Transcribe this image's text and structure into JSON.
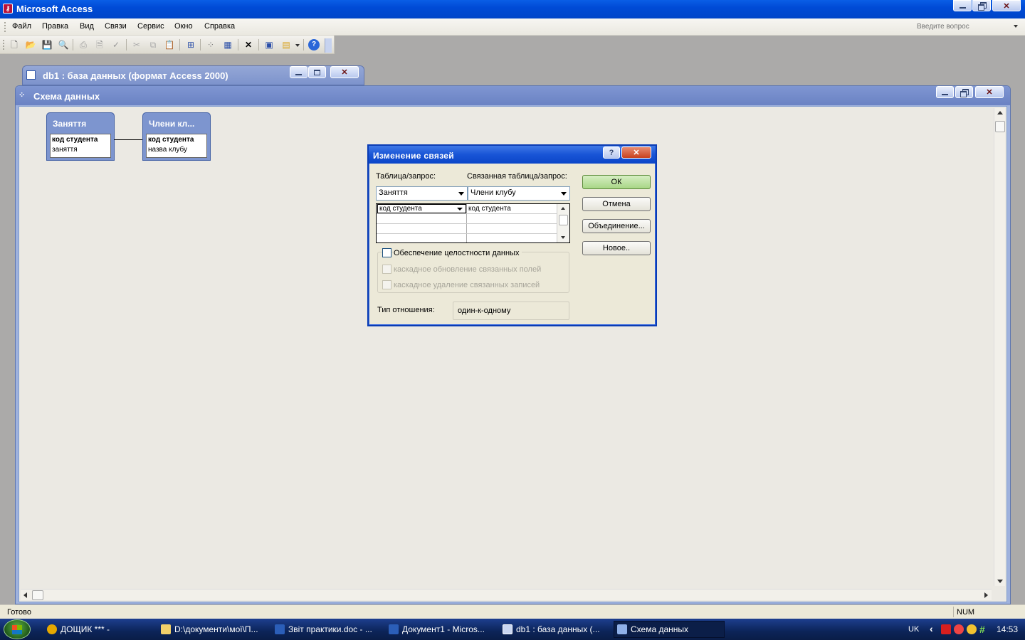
{
  "app": {
    "title": "Microsoft Access"
  },
  "menu": {
    "items": [
      "Файл",
      "Правка",
      "Вид",
      "Связи",
      "Сервис",
      "Окно",
      "Справка"
    ],
    "help_search_placeholder": "Введите вопрос"
  },
  "toolbar": {
    "icons": [
      "new-icon",
      "open-icon",
      "save-icon",
      "search-icon",
      "print-icon",
      "print-preview-icon",
      "spelling-icon",
      "cut-icon",
      "copy-icon",
      "paste-icon",
      "show-table-icon",
      "direct-relationships-icon",
      "all-relationships-icon",
      "delete-icon",
      "database-window-icon",
      "new-object-icon",
      "help-icon"
    ]
  },
  "db_window": {
    "title": "db1 : база данных (формат Access 2000)"
  },
  "schema_window": {
    "title": "Схема данных",
    "tables": [
      {
        "title": "Заняття",
        "fields": [
          "код студента",
          "заняття"
        ],
        "key_field": "код студента"
      },
      {
        "title": "Члени кл...",
        "fields": [
          "код студента",
          "назва клубу"
        ],
        "key_field": "код студента"
      }
    ]
  },
  "dialog": {
    "title": "Изменение связей",
    "table_label": "Таблица/запрос:",
    "related_label": "Связанная таблица/запрос:",
    "table_value": "Заняття",
    "related_value": "Члени клубу",
    "field_left": "код студента",
    "field_right": "код студента",
    "integrity_label": "Обеспечение целостности данных",
    "cascade_update_label": "каскадное обновление связанных полей",
    "cascade_delete_label": "каскадное удаление связанных записей",
    "relation_type_label": "Тип отношения:",
    "relation_type_value": "один-к-одному",
    "buttons": {
      "ok": "ОК",
      "cancel": "Отмена",
      "join": "Объединение...",
      "new": "Новое.."
    },
    "help_glyph": "?",
    "integrity_checked": false
  },
  "status": {
    "left": "Готово",
    "right": "NUM"
  },
  "taskbar": {
    "tasks": [
      "ДОЩИК *** -",
      "D:\\документи\\мої\\П...",
      "Звіт практики.doc - ...",
      "Документ1 - Micros...",
      "db1 : база данных (...",
      "Схема данных"
    ],
    "language": "UK",
    "clock": "14:53"
  },
  "colors": {
    "title_blue": "#0054e3",
    "mdi_title": "#7d93cc",
    "ok_green": "#a8d686"
  }
}
